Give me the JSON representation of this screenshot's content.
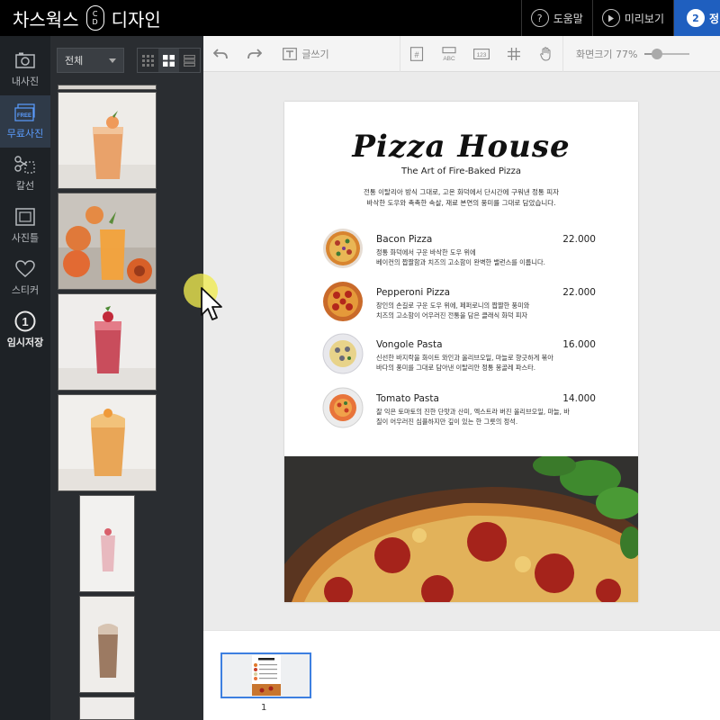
{
  "app": {
    "logo_left": "차스웍스",
    "logo_mark_top": "C",
    "logo_mark_bottom": "D",
    "logo_right": "디자인",
    "help_label": "도움말",
    "help_icon": "question-icon",
    "preview_label": "미리보기",
    "preview_icon": "play-icon",
    "step_number": "2",
    "step_label": "정"
  },
  "rail": [
    {
      "label": "내사진",
      "icon": "camera-icon"
    },
    {
      "label": "무료사진",
      "icon": "free-image-icon",
      "active": true
    },
    {
      "label": "칼선",
      "icon": "scissors-icon"
    },
    {
      "label": "사진틀",
      "icon": "frame-icon"
    },
    {
      "label": "스티커",
      "icon": "heart-icon"
    },
    {
      "label": "임시저장",
      "icon": "number-one-icon"
    }
  ],
  "panel": {
    "filter_value": "전체",
    "view_modes": [
      "grid-small",
      "grid-large",
      "list"
    ],
    "active_view": "grid-large"
  },
  "toolbar": {
    "text_label": "글쓰기",
    "zoom_label": "화면크기",
    "zoom_value": "77%",
    "zoom_level_percent": 77
  },
  "menu": {
    "title": "Pizza House",
    "subtitle": "The Art of Fire-Baked Pizza",
    "intro_line1": "전통 이탈리아 방식 그대로, 고온 화덕에서 단시간에 구워낸 정통 피자",
    "intro_line2": "바삭한 도우와 촉촉한 속살, 재료 본연의 풍미를 그대로 담았습니다.",
    "items": [
      {
        "name": "Bacon Pizza",
        "price": "22.000",
        "line1": "정통 화덕에서 구운 바삭한 도우 위에",
        "line2": "베이컨의 짭짤함과 치즈의 고소함이 완벽한 밸런스를 이룹니다."
      },
      {
        "name": "Pepperoni Pizza",
        "price": "22.000",
        "line1": "장인의 손길로 구운 도우 위에, 페퍼로니의 짭짤한 풍미와",
        "line2": "치즈의 고소함이 어우러진 전통을 담은 클래식 화덕 피자"
      },
      {
        "name": "Vongole Pasta",
        "price": "16.000",
        "line1": "신선한 바지락을 화이트 와인과 올리브오일, 마늘로 향긋하게 볶아",
        "line2": "바다의 풍미를 그대로 담아낸 이탈리안 정통 봉골레 파스타."
      },
      {
        "name": "Tomato Pasta",
        "price": "14.000",
        "line1": "잘 익은 토마토의 진한 단맛과 산미, 엑스트라 버진 올리브오일, 마늘, 바",
        "line2": "질이 어우러진 심플하지만 깊이 있는 한 그릇의 정석."
      }
    ]
  },
  "pages": {
    "current": "1"
  },
  "colors": {
    "header_bg": "#000000",
    "accent": "#1f5fbf",
    "active_rail": "#5b9dff",
    "rail_bg": "#1e2226",
    "panel_bg": "#2a2d31"
  }
}
